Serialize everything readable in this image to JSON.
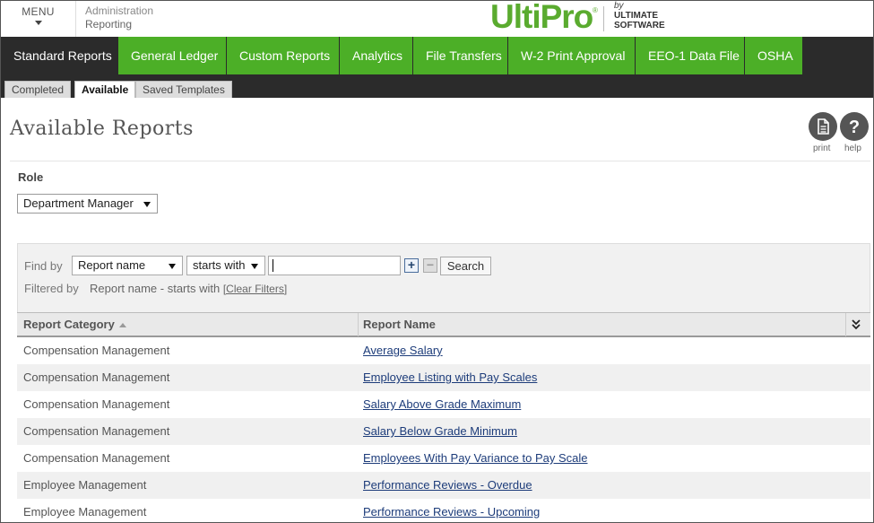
{
  "header": {
    "menu_label": "MENU",
    "crumb_1": "Administration",
    "crumb_2": "Reporting",
    "logo_text": "UltiPro",
    "logo_by": "by",
    "logo_company_1": "ULTIMATE",
    "logo_company_2": "SOFTWARE",
    "brand_color": "#5aab2f"
  },
  "main_tabs": [
    {
      "label": "Standard Reports",
      "active": true
    },
    {
      "label": "General Ledger"
    },
    {
      "label": "Custom Reports"
    },
    {
      "label": "Analytics"
    },
    {
      "label": "File Transfers"
    },
    {
      "label": "W-2 Print Approval"
    },
    {
      "label": "EEO-1 Data File"
    },
    {
      "label": "OSHA"
    }
  ],
  "sub_tabs": [
    {
      "label": "Completed"
    },
    {
      "label": "Available",
      "active": true
    },
    {
      "label": "Saved Templates"
    }
  ],
  "page": {
    "title": "Available Reports",
    "print_label": "print",
    "help_label": "help",
    "print_icon": "document-icon",
    "help_icon": "question-icon"
  },
  "role": {
    "label": "Role",
    "value": "Department Manager"
  },
  "filter": {
    "find_by_label": "Find by",
    "field_value": "Report name",
    "operator_value": "starts with",
    "search_value": "",
    "add_symbol": "+",
    "remove_symbol": "−",
    "search_label": "Search",
    "filtered_by_label": "Filtered by",
    "filter_summary": "Report name - starts with",
    "clear_label": "[Clear Filters]"
  },
  "table": {
    "col_category": "Report Category",
    "col_name": "Report Name",
    "rows": [
      {
        "category": "Compensation Management",
        "name": "Average Salary"
      },
      {
        "category": "Compensation Management",
        "name": "Employee Listing with Pay Scales"
      },
      {
        "category": "Compensation Management",
        "name": "Salary Above Grade Maximum"
      },
      {
        "category": "Compensation Management",
        "name": "Salary Below Grade Minimum"
      },
      {
        "category": "Compensation Management",
        "name": "Employees With Pay Variance to Pay Scale"
      },
      {
        "category": "Employee Management",
        "name": "Performance Reviews - Overdue"
      },
      {
        "category": "Employee Management",
        "name": "Performance Reviews - Upcoming"
      }
    ]
  }
}
